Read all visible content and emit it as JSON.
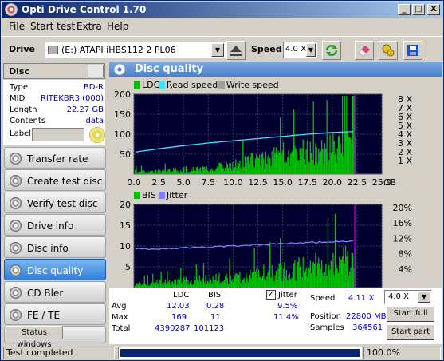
{
  "window": {
    "title": "Opti Drive Control 1.70",
    "min": "_",
    "max": "□",
    "close": "X"
  },
  "menu": [
    "File",
    "Start test",
    "Extra",
    "Help"
  ],
  "toolbar": {
    "drive_label": "Drive",
    "drive_value": "(E:)   ATAPI iHBS112   2 PL06",
    "speed_label": "Speed",
    "speed_value": "4.0 X"
  },
  "disc": {
    "header": "Disc",
    "rows": [
      {
        "k": "Type",
        "v": "BD-R"
      },
      {
        "k": "MID",
        "v": "RITEKBR3 (000)"
      },
      {
        "k": "Length",
        "v": "22.27 GB"
      },
      {
        "k": "Contents",
        "v": "data"
      }
    ],
    "label_key": "Label"
  },
  "nav": [
    "Transfer rate",
    "Create test disc",
    "Verify test disc",
    "Drive info",
    "Disc info",
    "Disc quality",
    "CD Bler",
    "FE / TE"
  ],
  "nav_selected": "Disc quality",
  "status_windows": "Status windows",
  "panel_title": "Disc quality",
  "chart_data": [
    {
      "type": "area",
      "legend": [
        "LDC",
        "Read speed",
        "Write speed"
      ],
      "colors": {
        "LDC": "#00c000",
        "Read speed": "#40e0ff",
        "Write speed": "#a0a0a0",
        "limit": "#a000c0"
      },
      "xlim": [
        0,
        25
      ],
      "xunit": "GB",
      "xticks": [
        "0.0",
        "2.5",
        "5.0",
        "7.5",
        "10.0",
        "12.5",
        "15.0",
        "17.5",
        "20.0",
        "22.5",
        "25.0"
      ],
      "ylim": [
        0,
        200
      ],
      "yticks": [
        "200",
        "150",
        "100",
        "50"
      ],
      "y2ticks": [
        "8 X",
        "7 X",
        "6 X",
        "5 X",
        "4 X",
        "3 X",
        "2 X",
        "1 X"
      ],
      "read_speed_x": [
        0,
        2.5,
        5,
        7.5,
        10,
        12.5,
        15,
        17.5,
        20,
        22.27
      ],
      "read_speed_y": [
        1.95,
        2.35,
        2.7,
        3.0,
        3.25,
        3.5,
        3.75,
        4.0,
        4.2,
        4.3
      ],
      "ldc_x": [
        0,
        2.5,
        5,
        7.5,
        10,
        12.5,
        15,
        17.5,
        20,
        22.27
      ],
      "ldc_y": [
        8,
        10,
        15,
        18,
        30,
        45,
        60,
        70,
        80,
        95
      ],
      "data_end": 22.27
    },
    {
      "type": "area",
      "legend": [
        "BIS",
        "Jitter"
      ],
      "colors": {
        "BIS": "#00c000",
        "Jitter": "#8080ff",
        "limit": "#a000c0"
      },
      "xlim": [
        0,
        25
      ],
      "xunit": "GB",
      "xticks": [
        "0.0",
        "2.5",
        "5.0",
        "7.5",
        "10.0",
        "12.5",
        "15.0",
        "17.5",
        "20.0",
        "22.5",
        "25.0"
      ],
      "ylim": [
        0,
        20
      ],
      "yticks": [
        "20",
        "15",
        "10",
        "5"
      ],
      "y2ticks": [
        "20%",
        "16%",
        "12%",
        "8%",
        "4%"
      ],
      "jitter_x": [
        0,
        2.5,
        5,
        7.5,
        10,
        12.5,
        15,
        17.5,
        20,
        22.27
      ],
      "jitter_y": [
        9.2,
        9.3,
        9.5,
        9.7,
        10.0,
        10.3,
        10.6,
        10.9,
        11.1,
        11.4
      ],
      "bis_x": [
        0,
        2.5,
        5,
        7.5,
        10,
        12.5,
        15,
        17.5,
        20,
        22.27
      ],
      "bis_y": [
        1,
        1.5,
        2,
        2.5,
        3,
        4,
        5,
        6,
        7,
        8
      ],
      "data_end": 22.27
    }
  ],
  "stats": {
    "col_ldc": "LDC",
    "col_bis": "BIS",
    "rows": [
      {
        "k": "Avg",
        "ldc": "12.03",
        "bis": "0.28"
      },
      {
        "k": "Max",
        "ldc": "169",
        "bis": "11"
      },
      {
        "k": "Total",
        "ldc": "4390287",
        "bis": "101123"
      }
    ],
    "jitter_label": "Jitter",
    "jitter_avg": "9.5%",
    "jitter_max": "11.4%",
    "speed_label": "Speed",
    "speed_value": "4.11 X",
    "speed_select": "4.0 X",
    "position_label": "Position",
    "position_value": "22800 MB",
    "samples_label": "Samples",
    "samples_value": "364561",
    "start_full": "Start full",
    "start_part": "Start part"
  },
  "status": {
    "text": "Test completed",
    "progress": 1.0,
    "percent": "100.0%"
  }
}
